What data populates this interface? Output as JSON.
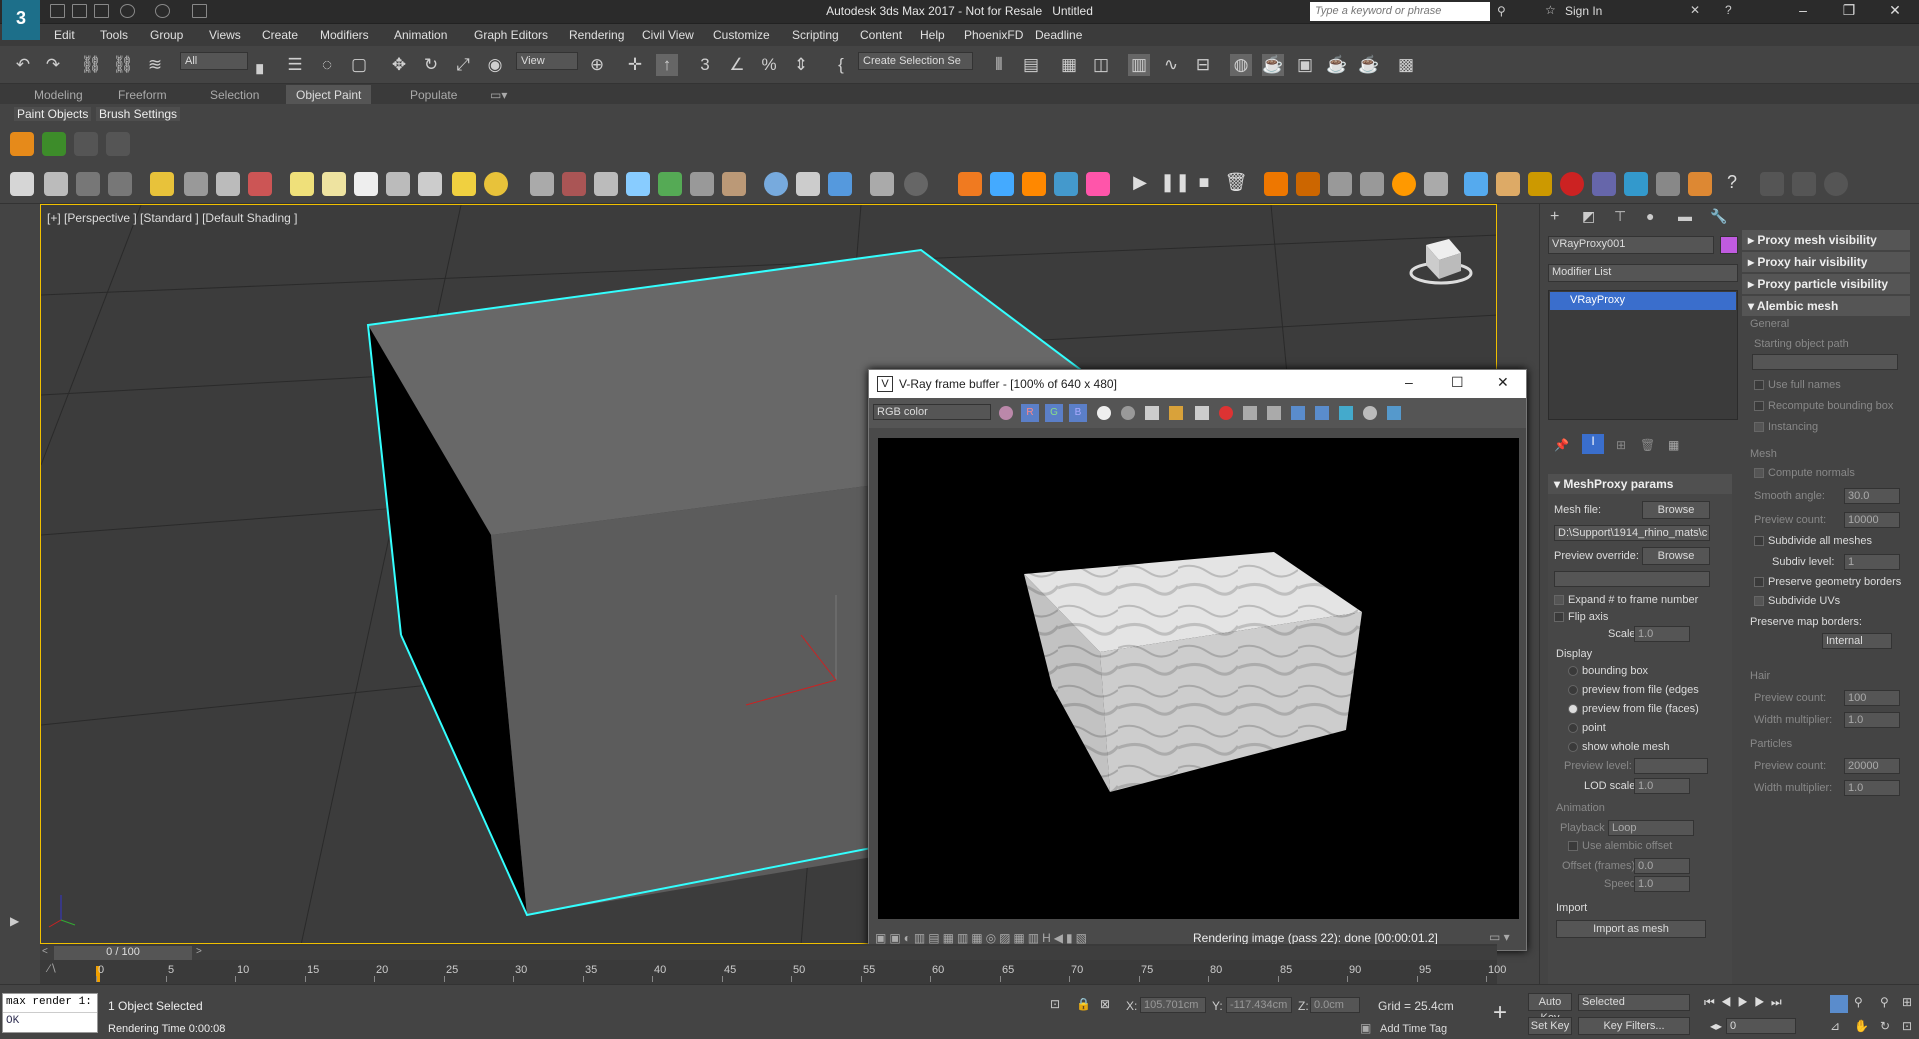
{
  "window": {
    "title": "Autodesk 3ds Max 2017 - Not for Resale",
    "file": "Untitled",
    "logo": "3"
  },
  "search": {
    "placeholder": "Type a keyword or phrase"
  },
  "account": {
    "sign_in": "Sign In"
  },
  "menu": [
    "Edit",
    "Tools",
    "Group",
    "Views",
    "Create",
    "Modifiers",
    "Animation",
    "Graph Editors",
    "Rendering",
    "Civil View",
    "Customize",
    "Scripting",
    "Content",
    "Help",
    "PhoenixFD",
    "Deadline"
  ],
  "toolbar": {
    "filter": "All",
    "ref_coord": "View",
    "selection_set": "Create Selection Se"
  },
  "ribbon": {
    "tabs": [
      "Modeling",
      "Freeform",
      "Selection",
      "Object Paint",
      "Populate"
    ],
    "active": "Object Paint",
    "subtabs": [
      "Paint Objects",
      "Brush Settings"
    ]
  },
  "viewport": {
    "label": "[+] [Perspective ] [Standard ] [Default Shading ]"
  },
  "vfb": {
    "title": "V-Ray frame buffer - [100% of 640 x 480]",
    "channel": "RGB color",
    "status": "Rendering image (pass 22): done [00:00:01.2]"
  },
  "command_panel": {
    "object_name": "VRayProxy001",
    "object_color": "#c05be0",
    "modifier_list": "Modifier List",
    "stack_item": "VRayProxy",
    "meshproxy": {
      "header": "MeshProxy params",
      "mesh_file_label": "Mesh file:",
      "browse": "Browse",
      "mesh_path": "D:\\Support\\1914_rhino_mats\\c",
      "preview_override_label": "Preview override:",
      "expand": "Expand # to frame number",
      "flip_axis": "Flip axis",
      "scale_label": "Scale:",
      "scale": "1.0",
      "display": "Display",
      "display_options": [
        "bounding box",
        "preview from file (edges",
        "preview from file (faces)",
        "point",
        "show whole mesh"
      ],
      "display_selected": "preview from file (faces)",
      "preview_level_label": "Preview level:",
      "lod_scale_label": "LOD scale:",
      "lod_scale": "1.0",
      "animation": "Animation",
      "playback_label": "Playback",
      "playback": "Loop",
      "use_alembic_offset": "Use alembic offset",
      "offset_label": "Offset (frames)",
      "offset": "0.0",
      "speed_label": "Speed",
      "speed": "1.0",
      "import": "Import",
      "import_as_mesh": "Import as mesh"
    }
  },
  "rollout": {
    "headers": [
      "Proxy mesh visibility",
      "Proxy hair visibility",
      "Proxy particle visibility",
      "Alembic mesh"
    ],
    "general": "General",
    "starting_object_path": "Starting object path",
    "use_full_names": "Use full names",
    "recompute_bbox": "Recompute bounding box",
    "instancing": "Instancing",
    "mesh": "Mesh",
    "compute_normals": "Compute normals",
    "smooth_angle_label": "Smooth angle:",
    "smooth_angle": "30.0",
    "preview_count_label": "Preview count:",
    "preview_count": "10000",
    "subdivide_all": "Subdivide all meshes",
    "subdiv_level_label": "Subdiv level:",
    "subdiv_level": "1",
    "preserve_geo": "Preserve geometry borders",
    "subdivide_uvs": "Subdivide UVs",
    "preserve_map_label": "Preserve map borders:",
    "preserve_map": "Internal",
    "hair": "Hair",
    "hair_preview_count": "100",
    "width_multiplier_label": "Width multiplier:",
    "width_multiplier": "1.0",
    "particles": "Particles",
    "particles_preview_count": "20000",
    "particles_width": "1.0"
  },
  "timeline": {
    "frame": "0 / 100",
    "ticks": [
      "0",
      "5",
      "10",
      "15",
      "20",
      "25",
      "30",
      "35",
      "40",
      "45",
      "50",
      "55",
      "60",
      "65",
      "70",
      "75",
      "80",
      "85",
      "90",
      "95",
      "100"
    ]
  },
  "status": {
    "maxscript_input": "max render 1:",
    "maxscript_output": "OK",
    "selected": "1 Object Selected",
    "render_time": "Rendering Time  0:00:08",
    "x_label": "X:",
    "x": "105.701cm",
    "y_label": "Y:",
    "y": "-117.434cm",
    "z_label": "Z:",
    "z": "0.0cm",
    "grid": "Grid = 25.4cm",
    "add_time_tag": "Add Time Tag",
    "auto_key": "Auto Key",
    "set_key": "Set Key",
    "key_mode": "Selected",
    "key_filters": "Key Filters...",
    "frame_field": "0"
  }
}
